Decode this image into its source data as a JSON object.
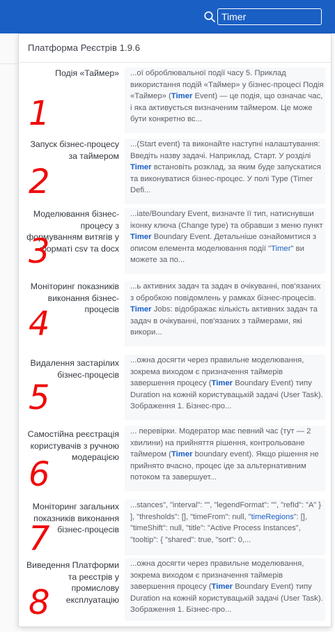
{
  "search": {
    "value": "Timer"
  },
  "dropdown": {
    "header": "Платформа Реєстрів 1.9.6"
  },
  "results": [
    {
      "title": "Подія «Таймер»",
      "snippet": "...ої оброблювальної події часу 5. Приклад використання подій «Таймер» у бізнес-процесі Подія «Таймер» (Timer Event) — це подія, що означає час, і яка активується визначеним таймером. Це може бути конкретно вс...",
      "annotation": "1"
    },
    {
      "title": "Запуск бізнес-процесу за таймером",
      "snippet": "...(Start event) та виконайте наступні налаштування: Введіть назву задачі. Наприклад, Старт. У розділі Timer встановіть розклад, за яким буде запускатися та виконуватися бізнес-процес. У полі Type (Timer Defi...",
      "annotation": "2"
    },
    {
      "title": "Моделювання бізнес-процесу з формуванням витягів у форматі csv та docx",
      "snippet": "...iate/Boundary Event, визначте її тип, натиснувши іконку ключа (Change type) та обравши з меню пункт Timer Boundary Event. Детальніше ознайомитися з описом елемента моделювання події \"Timer\" ви можете за по...",
      "annotation": "3"
    },
    {
      "title": "Моніторинг показників виконання бізнес-процесів",
      "snippet": "...ь активних задач та задач в очікуванні, пов'язаних з обробкою повідомлень у рамках бізнес-процесів. Timer Jobs: відображає кількість активних задач та задач в очікуванні, пов'язаних з таймерами, які викори...",
      "annotation": "4"
    },
    {
      "title": "Видалення застарілих бізнес-процесів",
      "snippet": "...ожна досягти через правильне моделювання, зокрема виходом є призначення таймерів завершення процесу (Timer Boundary Event) типу Duration на кожній користувацькій задачі (User Task). Зображення 1. Бізнес-про...",
      "annotation": "5"
    },
    {
      "title": "Самостійна реєстрація користувачів з ручною модерацією",
      "snippet": "... перевірки. Модератор має певний час (тут — 2 хвилини) на прийняття рішення, контрольоване таймером (Timer boundary event). Якщо рішення не прийнято вчасно, процес іде за альтернативним потоком та завершует...",
      "annotation": "6"
    },
    {
      "title": "Моніторинг загальних показників виконання бізнес-процесів",
      "snippet": "...stances\", \"interval\": \"\", \"legendFormat\": \"\", \"refId\": \"A\" } ], \"thresholds\": [], \"timeFrom\": null, \"timeRegions\": [], \"timeShift\": null, \"title\": \"Active Process Instances\", \"tooltip\": { \"shared\": true, \"sort\": 0,...",
      "annotation": "7"
    },
    {
      "title": "Виведення Платформи та реєстрів у промислову експлуатацію",
      "snippet": "...ожна досягти через правильне моделювання, зокрема виходом є призначення таймерів завершення процесу (Timer Boundary Event) типу Duration на кожній користувацькій задачі (User Task). Зображення 1. Бізнес-про...",
      "annotation": "8"
    }
  ],
  "colors": {
    "topbar": "#1a5fc4",
    "highlight": "#1a5fc4",
    "annotation": "#f00a0a"
  }
}
